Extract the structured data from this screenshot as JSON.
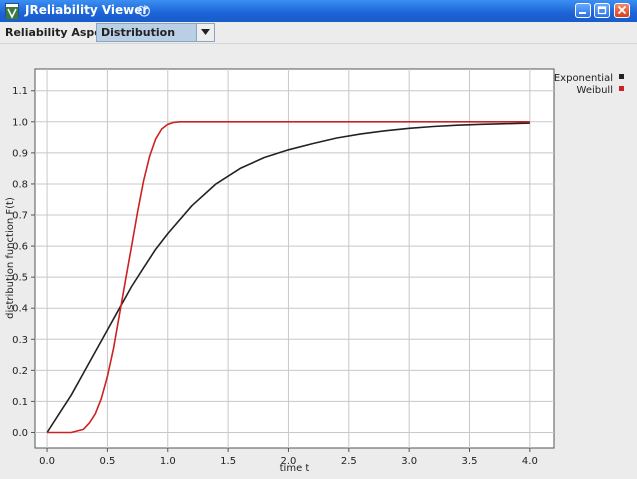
{
  "window": {
    "title": "JReliability Viewer",
    "icon": "app-logo-icon",
    "controls": [
      "minimize-icon",
      "maximize-icon",
      "close-icon"
    ]
  },
  "toolbar": {
    "aspect_label": "Reliability Aspect:",
    "aspect_value": "Distribution"
  },
  "colors": {
    "titlebar": "#1b63d6",
    "exponential": "#222222",
    "weibull": "#cc2222",
    "select_bg": "#b8cfe5"
  },
  "chart_data": {
    "type": "line",
    "xlabel": "time t",
    "ylabel": "distribution function F(t)",
    "xlim": [
      -0.1,
      4.2
    ],
    "ylim": [
      -0.05,
      1.17
    ],
    "xticks": [
      0.0,
      0.5,
      1.0,
      1.5,
      2.0,
      2.5,
      3.0,
      3.5,
      4.0
    ],
    "xtick_labels": [
      "0.0",
      "0.5",
      "1.0",
      "1.5",
      "2.0",
      "2.5",
      "3.0",
      "3.5",
      "4.0"
    ],
    "yticks": [
      0.0,
      0.1,
      0.2,
      0.3,
      0.4,
      0.5,
      0.6,
      0.7,
      0.8,
      0.9,
      1.0,
      1.1
    ],
    "ytick_labels": [
      "0.0",
      "0.1",
      "0.2",
      "0.3",
      "0.4",
      "0.5",
      "0.6",
      "0.7",
      "0.8",
      "0.9",
      "1.0",
      "1.1"
    ],
    "grid": true,
    "legend": "top-right",
    "series": [
      {
        "name": "Exponential",
        "color": "#222222",
        "x": [
          0,
          0.1,
          0.2,
          0.3,
          0.4,
          0.5,
          0.6,
          0.7,
          0.8,
          0.9,
          1.0,
          1.2,
          1.4,
          1.6,
          1.8,
          2.0,
          2.2,
          2.4,
          2.6,
          2.8,
          3.0,
          3.2,
          3.4,
          3.6,
          3.8,
          4.0
        ],
        "y": [
          0.0,
          0.06,
          0.12,
          0.19,
          0.26,
          0.33,
          0.4,
          0.47,
          0.53,
          0.59,
          0.64,
          0.73,
          0.8,
          0.85,
          0.885,
          0.91,
          0.93,
          0.948,
          0.961,
          0.971,
          0.979,
          0.985,
          0.989,
          0.992,
          0.994,
          0.996
        ]
      },
      {
        "name": "Weibull",
        "color": "#cc2222",
        "x": [
          0,
          0.1,
          0.2,
          0.3,
          0.35,
          0.4,
          0.45,
          0.5,
          0.55,
          0.6,
          0.65,
          0.7,
          0.75,
          0.8,
          0.85,
          0.9,
          0.95,
          1.0,
          1.05,
          1.1,
          1.15,
          1.2,
          1.5,
          2.0,
          2.5,
          3.0,
          3.5,
          4.0
        ],
        "y": [
          0.0,
          0.0,
          0.0,
          0.01,
          0.03,
          0.06,
          0.11,
          0.18,
          0.27,
          0.38,
          0.49,
          0.6,
          0.71,
          0.81,
          0.89,
          0.945,
          0.977,
          0.992,
          0.998,
          1.0,
          1.0,
          1.0,
          1.0,
          1.0,
          1.0,
          1.0,
          1.0,
          1.0
        ]
      }
    ]
  }
}
